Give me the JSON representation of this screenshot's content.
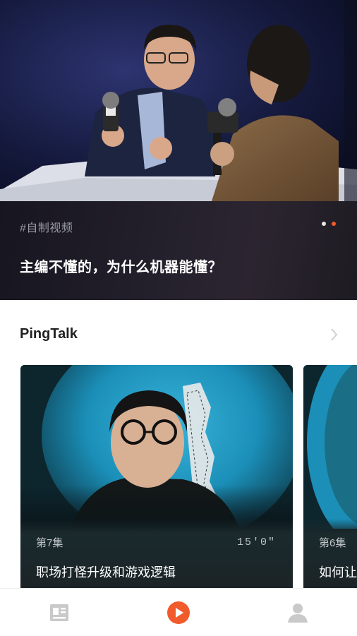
{
  "hero": {
    "tag": "#自制视频",
    "title": "主编不懂的，为什么机器能懂？",
    "dots": [
      {
        "active": false,
        "color": "#e6e6e6"
      },
      {
        "active": true,
        "color": "#f15a2b"
      }
    ]
  },
  "section": {
    "title": "PingTalk",
    "more_icon": "chevron-right-icon"
  },
  "cards": [
    {
      "episode": "第7集",
      "duration": "15'0\"",
      "title": "职场打怪升级和游戏逻辑"
    },
    {
      "episode": "第6集",
      "title": "如何让"
    }
  ],
  "tabbar": {
    "items": [
      {
        "icon": "news-feed-icon",
        "active": false
      },
      {
        "icon": "play-circle-icon",
        "active": true
      },
      {
        "icon": "user-icon",
        "active": false
      }
    ],
    "active_color": "#f15a2b",
    "inactive_color": "#c9c9c9"
  }
}
